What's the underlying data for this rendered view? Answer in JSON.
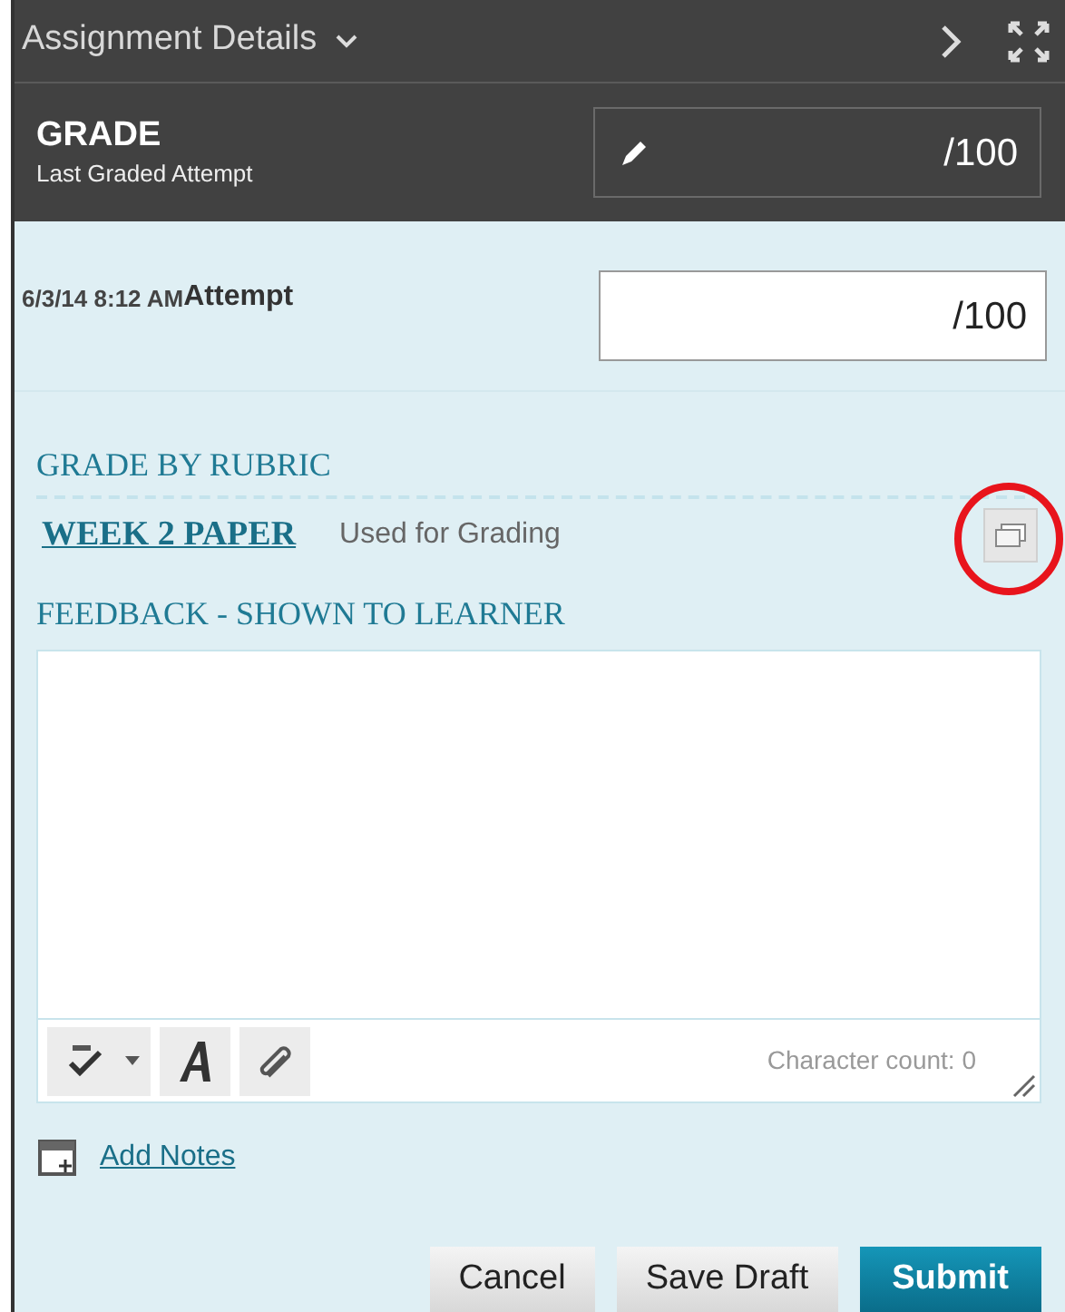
{
  "header": {
    "title": "Assignment Details"
  },
  "grade": {
    "title": "GRADE",
    "subtitle": "Last Graded Attempt",
    "value": "/100"
  },
  "attempt": {
    "date": "6/3/14 8:12 AM",
    "label": "Attempt",
    "value": "/100"
  },
  "rubric": {
    "heading": "GRADE BY RUBRIC",
    "name": "WEEK 2 PAPER",
    "status": "Used for Grading",
    "highlighted": true
  },
  "feedback": {
    "heading": "FEEDBACK - SHOWN TO LEARNER",
    "character_count": "Character count: 0"
  },
  "add_notes": "Add Notes",
  "buttons": [
    {
      "label": "Cancel",
      "kind": "secondary"
    },
    {
      "label": "Save Draft",
      "kind": "secondary"
    },
    {
      "label": "Submit",
      "kind": "primary"
    }
  ]
}
